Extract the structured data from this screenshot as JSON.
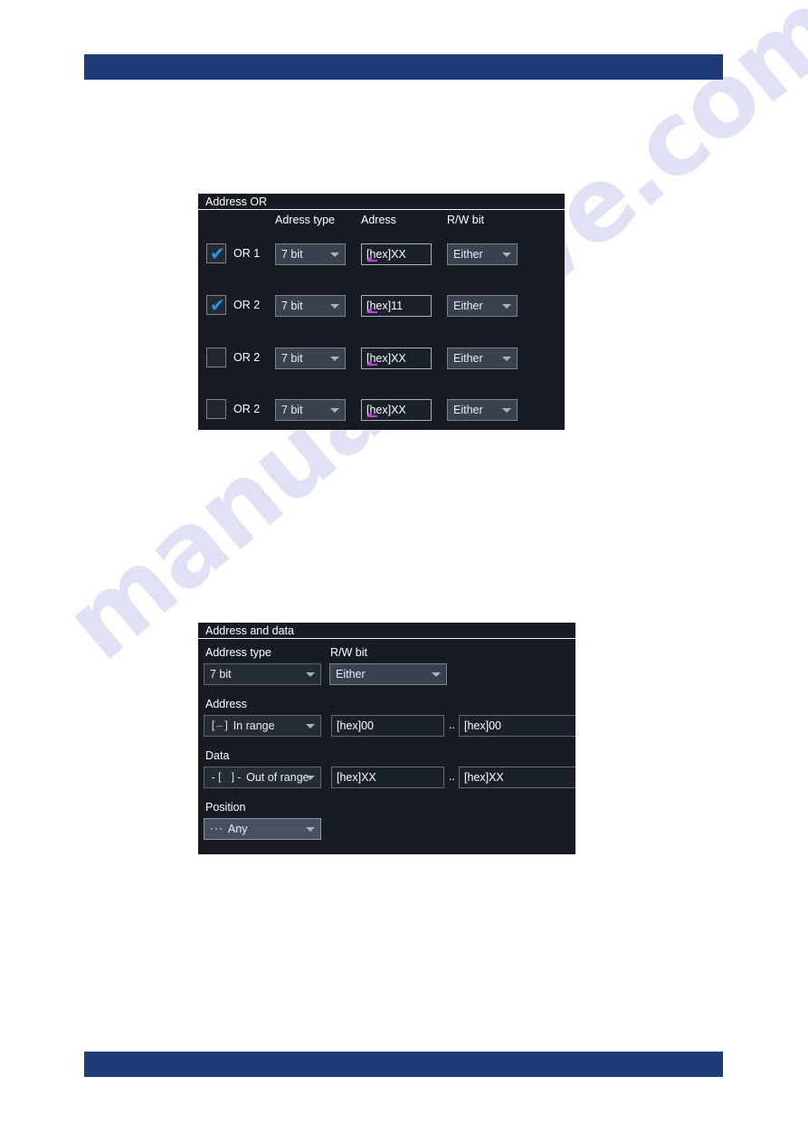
{
  "page": {
    "header_bar_color": "#1d3c79",
    "footer_bar_color": "#1d3c79",
    "watermark_text": "manualshive.com"
  },
  "panel_address_or": {
    "title": "Address OR",
    "column_headers": {
      "address_type": "Adress type",
      "address": "Adress",
      "rw_bit": "R/W bit"
    },
    "rows": [
      {
        "checked": true,
        "check_glyph": "✔",
        "label": "OR 1",
        "address_type": "7 bit",
        "address": "[hex]XX",
        "rw_bit": "Either"
      },
      {
        "checked": true,
        "check_glyph": "✔",
        "label": "OR 2",
        "address_type": "7 bit",
        "address": "[hex]11",
        "rw_bit": "Either"
      },
      {
        "checked": false,
        "check_glyph": "",
        "label": "OR 2",
        "address_type": "7 bit",
        "address": "[hex]XX",
        "rw_bit": "Either"
      },
      {
        "checked": false,
        "check_glyph": "",
        "label": "OR 2",
        "address_type": "7 bit",
        "address": "[hex]XX",
        "rw_bit": "Either"
      }
    ]
  },
  "panel_address_and_data": {
    "title": "Address and data",
    "labels": {
      "address_type": "Address type",
      "rw_bit": "R/W bit",
      "address": "Address",
      "data": "Data",
      "position": "Position"
    },
    "address_type_value": "7 bit",
    "rw_bit_value": "Either",
    "address_condition": {
      "icon": "in-range-icon",
      "icon_left": "[",
      "icon_bar": "–",
      "icon_right": "]",
      "label": "In range"
    },
    "address_min": "[hex]00",
    "address_separator": "..",
    "address_max": "[hex]00",
    "data_condition": {
      "icon": "out-of-range-icon",
      "icon_text": "-[ ]-",
      "label": "Out of range"
    },
    "data_min": "[hex]XX",
    "data_separator": "..",
    "data_max": "[hex]XX",
    "position_value": {
      "icon": "any-position-icon",
      "icon_text": "···",
      "label": "Any"
    }
  }
}
